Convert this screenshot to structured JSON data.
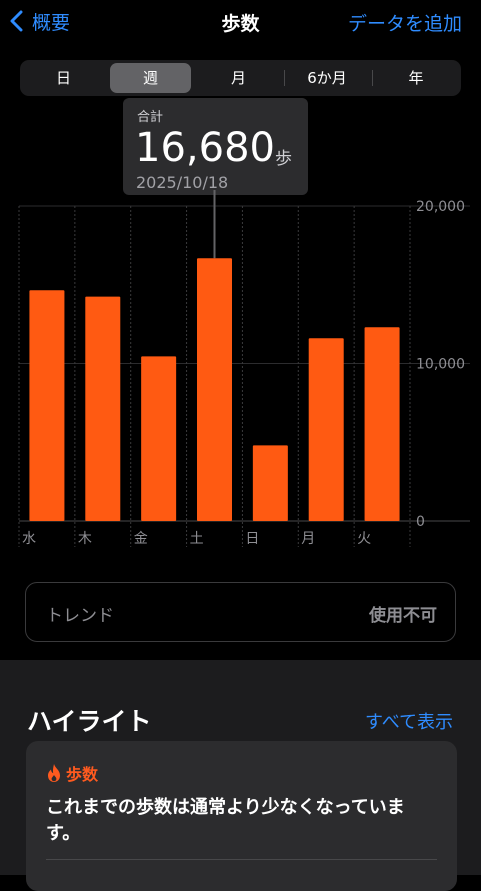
{
  "nav": {
    "back_label": "概要",
    "title": "歩数",
    "add_label": "データを追加"
  },
  "segments": [
    "日",
    "週",
    "月",
    "6か月",
    "年"
  ],
  "selected_segment": "週",
  "tooltip": {
    "label": "合計",
    "value": "16,680",
    "unit": "歩",
    "date": "2025/10/18"
  },
  "chart_data": {
    "type": "bar",
    "categories": [
      "水",
      "木",
      "金",
      "土",
      "日",
      "月",
      "火"
    ],
    "values": [
      14650,
      14250,
      10450,
      16680,
      4800,
      11600,
      12300
    ],
    "ylim": [
      0,
      20000
    ],
    "yticks": [
      "20,000",
      "10,000",
      "0"
    ],
    "bar_color": "#ff5a12",
    "highlighted_category": "土"
  },
  "trend": {
    "label": "トレンド",
    "status": "使用不可"
  },
  "highlights": {
    "title": "ハイライト",
    "show_all": "すべて表示",
    "card_title": "歩数",
    "card_message": "これまでの歩数は通常より少なくなっています。",
    "accent": "#ff5a1f"
  }
}
